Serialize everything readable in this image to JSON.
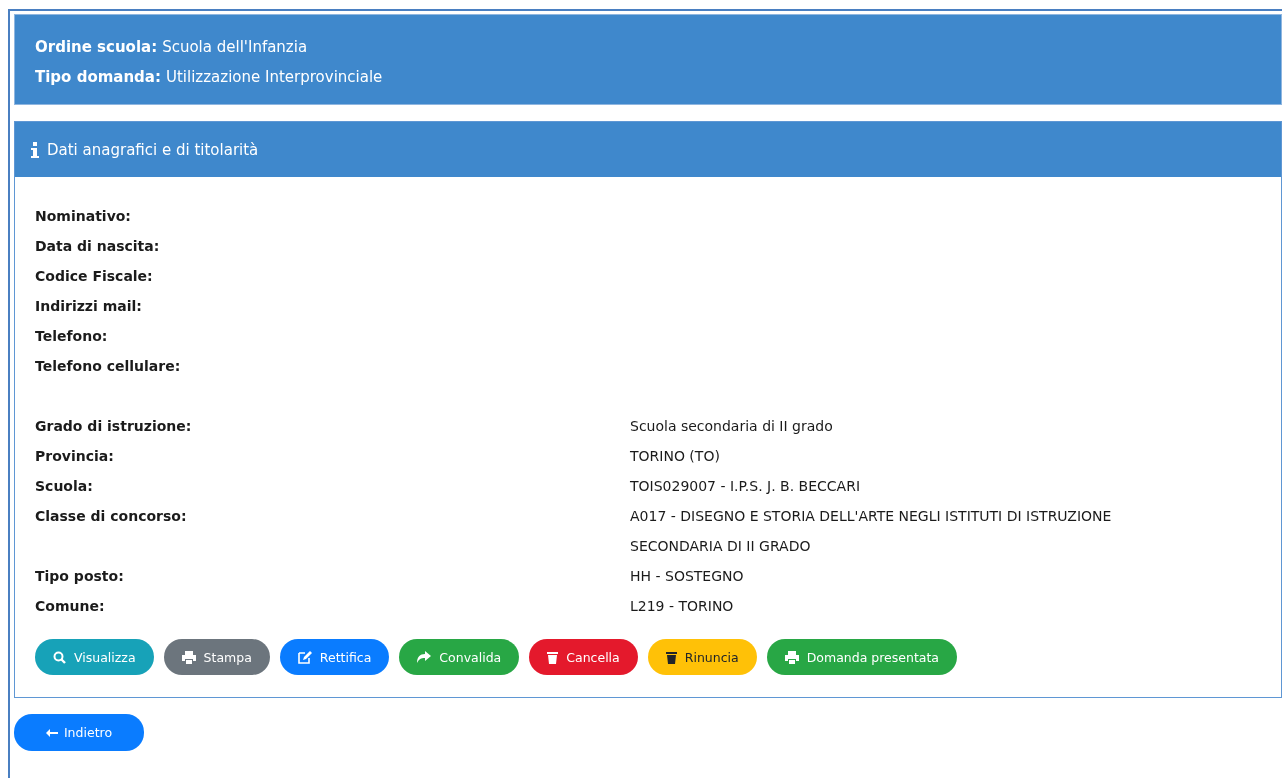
{
  "summary": [
    {
      "label": "Ordine scuola:",
      "value": "Scuola dell'Infanzia"
    },
    {
      "label": "Tipo domanda:",
      "value": "Utilizzazione Interprovinciale"
    }
  ],
  "panel": {
    "title": "Dati anagrafici e di titolarità",
    "personal": [
      {
        "label": "Nominativo:"
      },
      {
        "label": "Data di nascita:"
      },
      {
        "label": "Codice Fiscale:"
      },
      {
        "label": "Indirizzi mail:"
      },
      {
        "label": "Telefono:"
      },
      {
        "label": "Telefono cellulare:"
      }
    ],
    "titolarita": [
      {
        "label": "Grado di istruzione:",
        "value": "Scuola secondaria di II grado"
      },
      {
        "label": "Provincia:",
        "value": "TORINO (TO)"
      },
      {
        "label": "Scuola:",
        "value": "TOIS029007 - I.P.S. J. B. BECCARI"
      },
      {
        "label": "Classe di concorso:",
        "value": "A017 - DISEGNO E STORIA DELL'ARTE NEGLI ISTITUTI DI ISTRUZIONE SECONDARIA DI II GRADO"
      },
      {
        "label": "Tipo posto:",
        "value": "HH - SOSTEGNO"
      },
      {
        "label": "Comune:",
        "value": "L219 - TORINO"
      }
    ],
    "buttons": [
      {
        "label": "Visualizza",
        "kind": "search",
        "color": "#17a2b8"
      },
      {
        "label": "Stampa",
        "kind": "print",
        "color": "#6c757d"
      },
      {
        "label": "Rettifica",
        "kind": "edit",
        "color": "#0a7cff"
      },
      {
        "label": "Convalida",
        "kind": "share",
        "color": "#28a745"
      },
      {
        "label": "Cancella",
        "kind": "trash",
        "color": "#e4192c"
      },
      {
        "label": "Rinuncia",
        "kind": "trash",
        "color": "#ffc107"
      },
      {
        "label": "Domanda presentata",
        "kind": "print",
        "color": "#28a745"
      }
    ]
  },
  "back_button": {
    "label": "Indietro"
  }
}
